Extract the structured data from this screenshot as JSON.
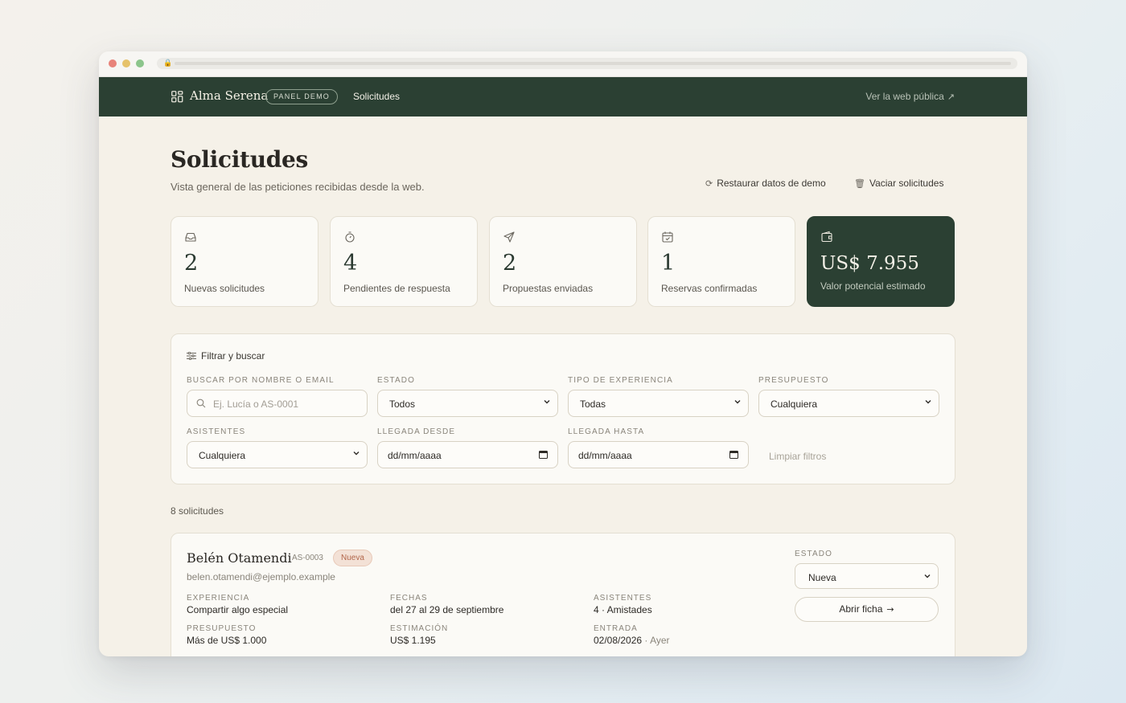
{
  "header": {
    "brand": "Alma Serena",
    "badge": "PANEL DEMO",
    "nav_item": "Solicitudes",
    "public_link": "Ver la web pública"
  },
  "page": {
    "title": "Solicitudes",
    "subtitle": "Vista general de las peticiones recibidas desde la web.",
    "actions": {
      "restore": "Restaurar datos de demo",
      "empty": "Vaciar solicitudes"
    }
  },
  "stats": [
    {
      "icon": "inbox-icon",
      "value": "2",
      "label": "Nuevas solicitudes"
    },
    {
      "icon": "timer-icon",
      "value": "4",
      "label": "Pendientes de respuesta"
    },
    {
      "icon": "send-icon",
      "value": "2",
      "label": "Propuestas enviadas"
    },
    {
      "icon": "calendar-check-icon",
      "value": "1",
      "label": "Reservas confirmadas"
    },
    {
      "icon": "wallet-icon",
      "value": "US$ 7.955",
      "label": "Valor potencial estimado"
    }
  ],
  "filters": {
    "title": "Filtrar y buscar",
    "search_label": "BUSCAR POR NOMBRE O EMAIL",
    "search_placeholder": "Ej. Lucía o AS-0001",
    "estado_label": "ESTADO",
    "estado_value": "Todos",
    "tipo_label": "TIPO DE EXPERIENCIA",
    "tipo_value": "Todas",
    "presupuesto_label": "PRESUPUESTO",
    "presupuesto_value": "Cualquiera",
    "asistentes_label": "ASISTENTES",
    "asistentes_value": "Cualquiera",
    "llegada_desde_label": "LLEGADA DESDE",
    "llegada_desde_value": "dd/mm/aaaa",
    "llegada_hasta_label": "LLEGADA HASTA",
    "llegada_hasta_value": "dd/mm/aaaa",
    "clear": "Limpiar filtros"
  },
  "results_count": "8 solicitudes",
  "request": {
    "name": "Belén Otamendi",
    "code": "AS-0003",
    "status_badge": "Nueva",
    "email": "belen.otamendi@ejemplo.example",
    "experiencia_label": "EXPERIENCIA",
    "experiencia": "Compartir algo especial",
    "fechas_label": "FECHAS",
    "fechas": "del 27 al 29 de septiembre",
    "asistentes_label": "ASISTENTES",
    "asistentes": "4 · Amistades",
    "presupuesto_label": "PRESUPUESTO",
    "presupuesto": "Más de US$ 1.000",
    "estimacion_label": "ESTIMACIÓN",
    "estimacion": "US$ 1.195",
    "entrada_label": "ENTRADA",
    "entrada_date": "02/08/2026",
    "entrada_rel": "· Ayer",
    "estado_label": "ESTADO",
    "estado_value": "Nueva",
    "open_button": "Abrir ficha"
  },
  "colors": {
    "header_bg": "#2b4033",
    "page_bg": "#f5f1e8",
    "card_bg": "#fbfaf6",
    "badge_nueva_bg": "#f3e1d6",
    "badge_nueva_text": "#b2664a"
  }
}
